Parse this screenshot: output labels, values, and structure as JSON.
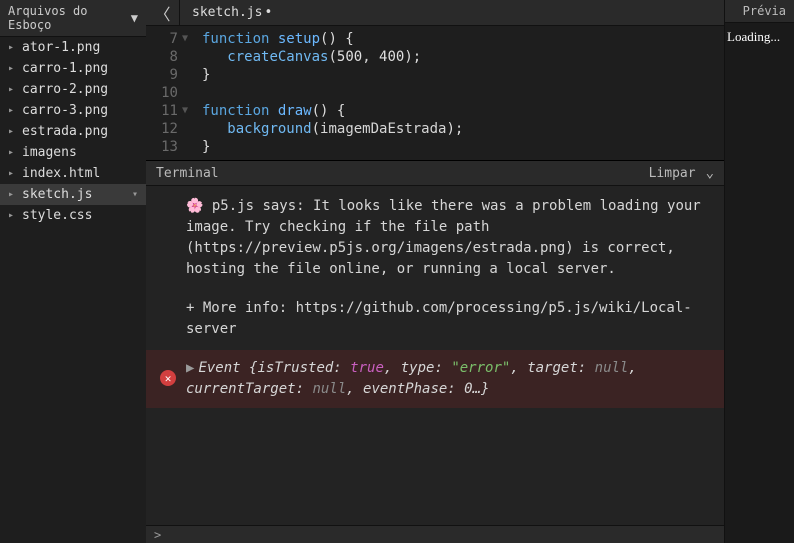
{
  "sidebar": {
    "title": "Arquivos do Esboço",
    "items": [
      {
        "label": "ator-1.png",
        "expandable": true
      },
      {
        "label": "carro-1.png",
        "expandable": true
      },
      {
        "label": "carro-2.png",
        "expandable": true
      },
      {
        "label": "carro-3.png",
        "expandable": true
      },
      {
        "label": "estrada.png",
        "expandable": true
      },
      {
        "label": "imagens",
        "expandable": true
      },
      {
        "label": "index.html",
        "expandable": true
      },
      {
        "label": "sketch.js",
        "expandable": true,
        "active": true
      },
      {
        "label": "style.css",
        "expandable": true
      }
    ]
  },
  "tab": {
    "label": "sketch.js",
    "dirty": "•"
  },
  "code": {
    "lines": [
      {
        "n": 7,
        "fold": true,
        "tokens": [
          [
            "kw",
            "function "
          ],
          [
            "fname",
            "setup"
          ],
          [
            "paren",
            "() {"
          ]
        ]
      },
      {
        "n": 8,
        "fold": false,
        "tokens": [
          [
            "txt",
            "   "
          ],
          [
            "call",
            "createCanvas"
          ],
          [
            "paren",
            "("
          ],
          [
            "num",
            "500"
          ],
          [
            "txt",
            ", "
          ],
          [
            "num",
            "400"
          ],
          [
            "paren",
            ");"
          ]
        ]
      },
      {
        "n": 9,
        "fold": false,
        "tokens": [
          [
            "paren",
            "}"
          ]
        ]
      },
      {
        "n": 10,
        "fold": false,
        "tokens": []
      },
      {
        "n": 11,
        "fold": true,
        "tokens": [
          [
            "kw",
            "function "
          ],
          [
            "fname",
            "draw"
          ],
          [
            "paren",
            "() {"
          ]
        ]
      },
      {
        "n": 12,
        "fold": false,
        "tokens": [
          [
            "txt",
            "   "
          ],
          [
            "call",
            "background"
          ],
          [
            "paren",
            "("
          ],
          [
            "ident",
            "imagemDaEstrada"
          ],
          [
            "paren",
            ");"
          ]
        ]
      },
      {
        "n": 13,
        "fold": false,
        "tokens": [
          [
            "paren",
            "}"
          ]
        ]
      }
    ]
  },
  "terminal": {
    "title": "Terminal",
    "clear": "Limpar",
    "message": {
      "emoji": "🌸",
      "line1": " p5.js says: It looks like there was a problem loading your image. Try checking if the file path (https://preview.p5js.org/imagens/estrada.png) is correct, hosting the file online, or running a local server.",
      "line2": "+ More info: https://github.com/processing/p5.js/wiki/Local-server"
    },
    "error": {
      "prefix": "Event ",
      "parts": [
        [
          "kv-key",
          "{isTrusted: "
        ],
        [
          "kv-true",
          "true"
        ],
        [
          "kv-key",
          ", type: "
        ],
        [
          "kv-str",
          "\"error\""
        ],
        [
          "kv-key",
          ", target: "
        ],
        [
          "kv-null",
          "null"
        ],
        [
          "kv-key",
          ", currentTarget: "
        ],
        [
          "kv-null",
          "null"
        ],
        [
          "kv-key",
          ", eventPhase: "
        ],
        [
          "ident",
          "0…"
        ],
        [
          "kv-key",
          "}"
        ]
      ]
    }
  },
  "preview": {
    "title": "Prévia",
    "body": "Loading..."
  },
  "bottom": {
    "prompt": ">"
  }
}
